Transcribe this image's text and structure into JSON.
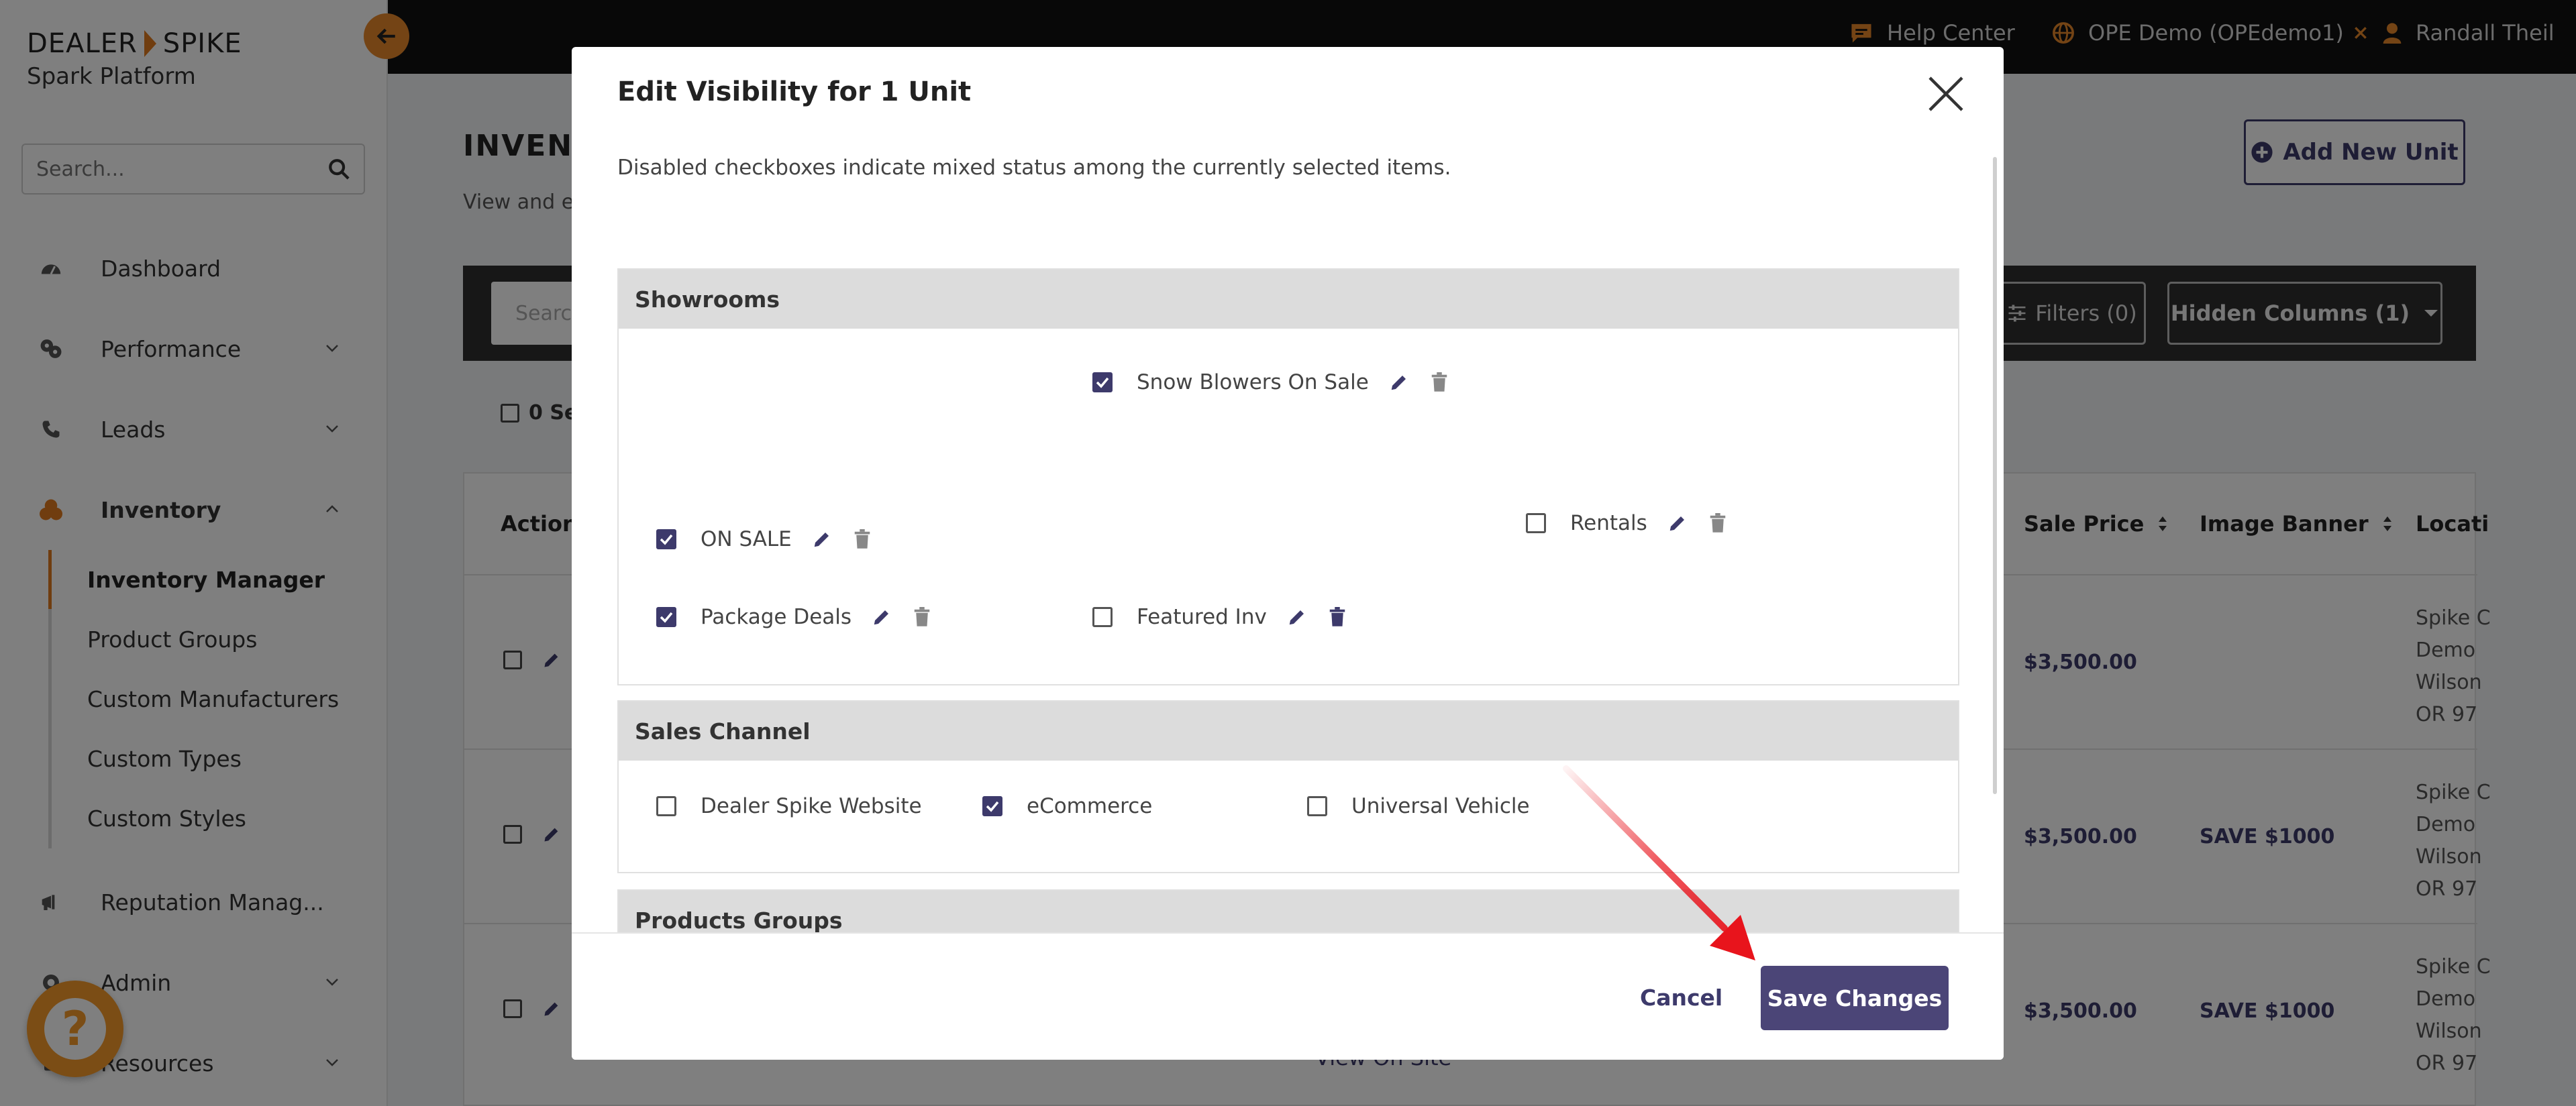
{
  "brand": {
    "name_left": "DEALER",
    "name_right": "SPIKE",
    "subtitle": "Spark Platform"
  },
  "sidebar": {
    "search_placeholder": "Search...",
    "items": [
      {
        "label": "Dashboard",
        "icon": "dashboard-icon"
      },
      {
        "label": "Performance",
        "icon": "performance-icon"
      },
      {
        "label": "Leads",
        "icon": "phone-icon"
      },
      {
        "label": "Inventory",
        "icon": "inventory-icon"
      }
    ],
    "inventory_sub": [
      "Inventory Manager",
      "Product Groups",
      "Custom Manufacturers",
      "Custom Types",
      "Custom Styles"
    ],
    "items_bottom": [
      {
        "label": "Reputation Manag...",
        "icon": "megaphone-icon"
      },
      {
        "label": "Admin",
        "icon": "admin-icon"
      },
      {
        "label": "Resources",
        "icon": "resources-icon"
      }
    ]
  },
  "topbar": {
    "help_center": "Help Center",
    "dealer": "OPE Demo (OPEdemo1)",
    "user": "Randall Theil"
  },
  "main": {
    "title_partial": "INVENT",
    "desc_partial": "View and ed",
    "add_unit": "Add New Unit",
    "search_partial": "Searc",
    "filters": "Filters (0)",
    "hidden_columns": "Hidden Columns (1)",
    "selected_partial": "0 Se",
    "columns": {
      "actions": "Actions",
      "sale_price": "Sale Price",
      "image_banner": "Image Banner",
      "location": "Locati"
    },
    "rows": [
      {
        "price": "$3,500.00",
        "banner": "",
        "loc": [
          "Spike C",
          "Demo",
          "Wilson",
          "OR 97"
        ]
      },
      {
        "price": "$3,500.00",
        "banner": "SAVE $1000",
        "loc": [
          "Spike C",
          "Demo",
          "Wilson",
          "OR 97"
        ]
      },
      {
        "price": "$3,500.00",
        "banner": "SAVE $1000",
        "loc": [
          "Spike C",
          "Demo",
          "Wilson",
          "OR 97"
        ]
      }
    ],
    "view_on_site": "View On Site"
  },
  "modal": {
    "title": "Edit Visibility for 1 Unit",
    "note": "Disabled checkboxes indicate mixed status among the currently selected items.",
    "sections": {
      "showrooms": {
        "title": "Showrooms",
        "options": [
          {
            "label": "Snow Blowers On Sale",
            "checked": true
          },
          {
            "label": "ON SALE",
            "checked": true
          },
          {
            "label": "Rentals",
            "checked": false
          },
          {
            "label": "Package Deals",
            "checked": true
          },
          {
            "label": "Featured Inv",
            "checked": false
          }
        ]
      },
      "sales_channel": {
        "title": "Sales Channel",
        "options": [
          {
            "label": "Dealer Spike Website",
            "checked": false
          },
          {
            "label": "eCommerce",
            "checked": true
          },
          {
            "label": "Universal Vehicle",
            "checked": false
          }
        ]
      },
      "product_groups": {
        "title": "Products Groups"
      }
    },
    "cancel": "Cancel",
    "save": "Save Changes"
  },
  "colors": {
    "accent": "#3d3a6b",
    "orange": "#e07b1f",
    "arrow": "#e8141c"
  }
}
